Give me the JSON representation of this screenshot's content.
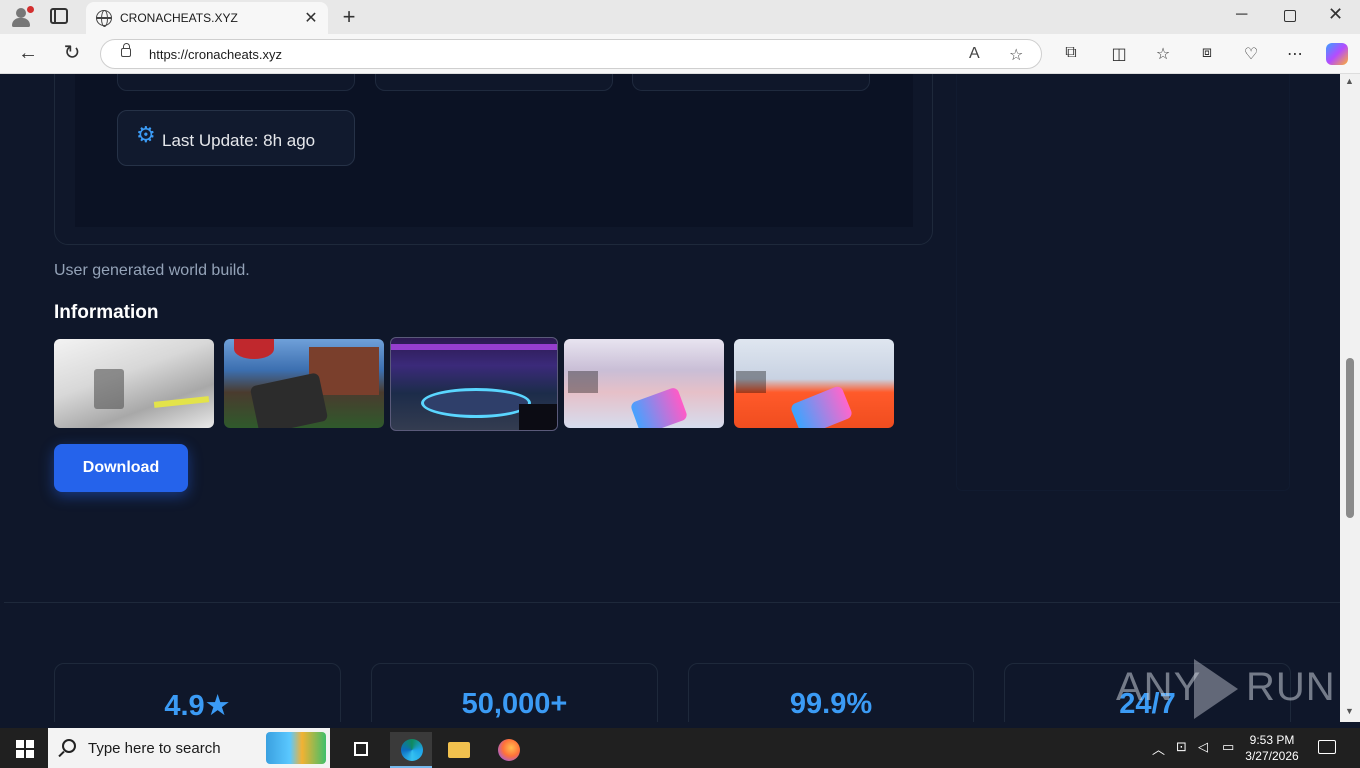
{
  "browser": {
    "tab_title": "CRONACHEATS.XYZ",
    "url": "https://cronacheats.xyz",
    "new_tab_symbol": "+",
    "close_symbol": "✕",
    "window_min": "─",
    "window_close": "✕"
  },
  "page": {
    "last_update": "Last Update: 8h ago",
    "description": "User generated world build.",
    "info_heading": "Information",
    "download_label": "Download",
    "screenshots": [
      "screenshot-1",
      "screenshot-2",
      "screenshot-3",
      "screenshot-4",
      "screenshot-5"
    ],
    "stats": [
      {
        "value": "4.9★"
      },
      {
        "value": "50,000+"
      },
      {
        "value": "99.9%"
      },
      {
        "value": "24/7"
      }
    ]
  },
  "watermark": {
    "left": "ANY",
    "right": "RUN"
  },
  "taskbar": {
    "search_placeholder": "Type here to search",
    "time": "9:53 PM",
    "date": "3/27/2026"
  },
  "colors": {
    "accent": "#3b9bf5",
    "button": "#2563eb",
    "background": "#0f172a"
  }
}
